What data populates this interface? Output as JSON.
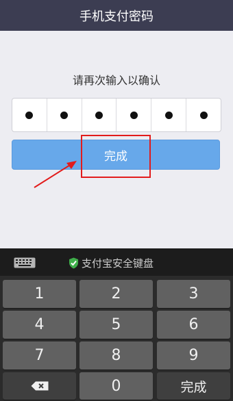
{
  "header": {
    "title": "手机支付密码"
  },
  "main": {
    "prompt": "请再次输入以确认",
    "pin_dots": 6,
    "done_label": "完成"
  },
  "keyboard": {
    "title": "支付宝安全键盘",
    "keys": [
      "1",
      "2",
      "3",
      "4",
      "5",
      "6",
      "7",
      "8",
      "9",
      "0"
    ],
    "done_label": "完成"
  },
  "colors": {
    "header_bg": "#3c3d52",
    "done_button": "#67a8ea",
    "annotation_red": "#e21b1b",
    "shield_green": "#3fae4a"
  }
}
